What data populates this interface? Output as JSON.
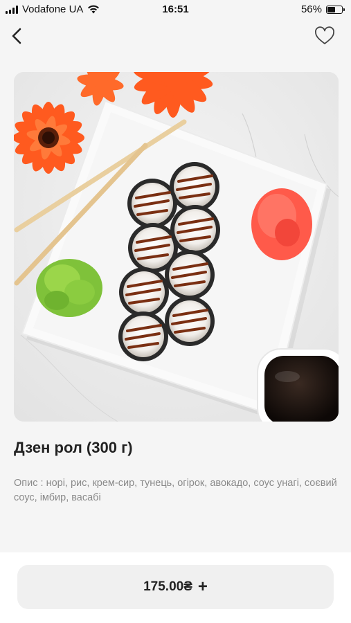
{
  "status_bar": {
    "carrier": "Vodafone UA",
    "time": "16:51",
    "battery": "56%",
    "battery_level": 0.56
  },
  "nav": {
    "back_icon": "chevron-left-icon",
    "favorite_icon": "heart-outline-icon"
  },
  "product": {
    "title": "Дзен рол (300 г)",
    "description": "Опис : норі, рис, крем-сир, тунець, огірок, авокадо, соус унагі, соєвий соус, імбир, васабі",
    "price": "175.00₴",
    "add_icon": "+"
  },
  "colors": {
    "background": "#f5f5f5",
    "text": "#2b2b2b",
    "description": "#8a8a8a",
    "button_bg": "#f0f0f0"
  }
}
